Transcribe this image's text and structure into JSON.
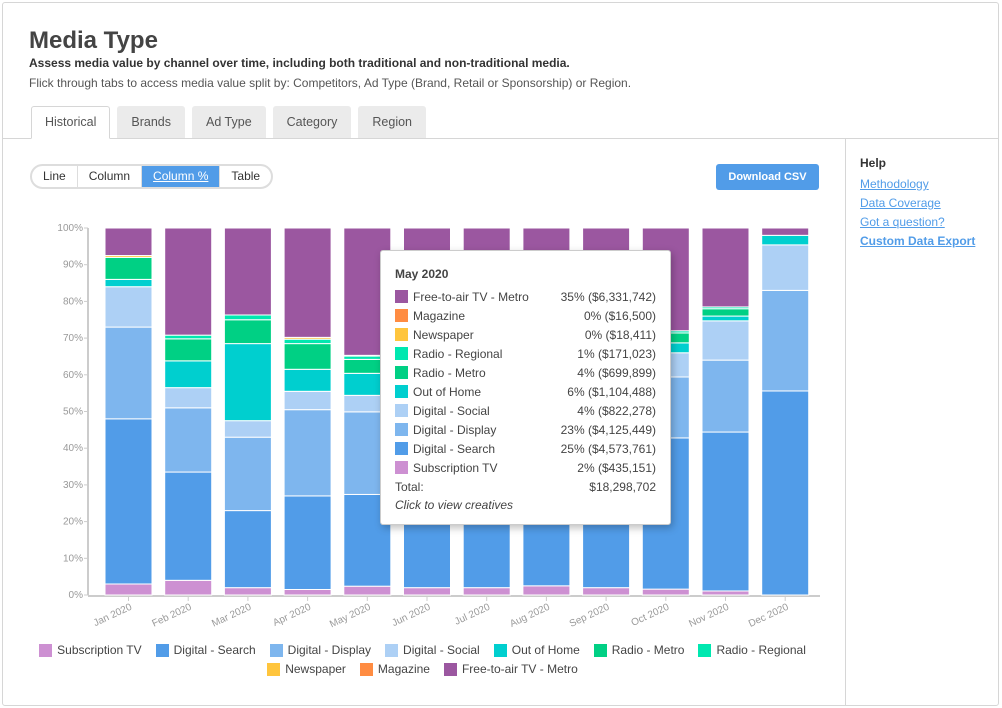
{
  "header": {
    "title": "Media Type",
    "subtitle": "Assess media value by channel over time, including both traditional and non-traditional media.",
    "description": "Flick through tabs to access media value split by: Competitors, Ad Type (Brand, Retail or Sponsorship) or Region."
  },
  "tabs": [
    {
      "label": "Historical",
      "active": true
    },
    {
      "label": "Brands"
    },
    {
      "label": "Ad Type"
    },
    {
      "label": "Category"
    },
    {
      "label": "Region"
    }
  ],
  "view_toggle": [
    {
      "label": "Line"
    },
    {
      "label": "Column"
    },
    {
      "label": "Column %",
      "active": true
    },
    {
      "label": "Table"
    }
  ],
  "download_label": "Download CSV",
  "help": {
    "title": "Help",
    "links": [
      "Methodology",
      "Data Coverage",
      "Got a question?",
      "Custom Data Export"
    ]
  },
  "legend": [
    "Subscription TV",
    "Digital - Search",
    "Digital - Display",
    "Digital - Social",
    "Out of Home",
    "Radio - Metro",
    "Radio - Regional",
    "Newspaper",
    "Magazine",
    "Free-to-air TV - Metro"
  ],
  "tooltip": {
    "title": "May 2020",
    "rows": [
      {
        "label": "Free-to-air TV - Metro",
        "value": "35% ($6,331,742)",
        "color": "#9b57a0"
      },
      {
        "label": "Magazine",
        "value": "0% ($16,500)",
        "color": "#ff8c42"
      },
      {
        "label": "Newspaper",
        "value": "0% ($18,411)",
        "color": "#ffc53d"
      },
      {
        "label": "Radio - Regional",
        "value": "1% ($171,023)",
        "color": "#00e8b0"
      },
      {
        "label": "Radio - Metro",
        "value": "4% ($699,899)",
        "color": "#00d084"
      },
      {
        "label": "Out of Home",
        "value": "6% ($1,104,488)",
        "color": "#00cfcf"
      },
      {
        "label": "Digital - Social",
        "value": "4% ($822,278)",
        "color": "#add0f5"
      },
      {
        "label": "Digital - Display",
        "value": "23% ($4,125,449)",
        "color": "#7eb6ee"
      },
      {
        "label": "Digital - Search",
        "value": "25% ($4,573,761)",
        "color": "#519ce8"
      },
      {
        "label": "Subscription TV",
        "value": "2% ($435,151)",
        "color": "#cd90d2"
      }
    ],
    "total_label": "Total:",
    "total_value": "$18,298,702",
    "hint": "Click to view creatives"
  },
  "chart_data": {
    "type": "bar",
    "stacked": "percent",
    "ylim": [
      0,
      100
    ],
    "yticks": [
      "0%",
      "10%",
      "20%",
      "30%",
      "40%",
      "50%",
      "60%",
      "70%",
      "80%",
      "90%",
      "100%"
    ],
    "categories": [
      "Jan 2020",
      "Feb 2020",
      "Mar 2020",
      "Apr 2020",
      "May 2020",
      "Jun 2020",
      "Jul 2020",
      "Aug 2020",
      "Sep 2020",
      "Oct 2020",
      "Nov 2020",
      "Dec 2020"
    ],
    "legend_position": "bottom",
    "series": [
      {
        "name": "Subscription TV",
        "color": "#cd90d2",
        "values": [
          3,
          4,
          2,
          1.5,
          2.4,
          2,
          2,
          2.5,
          2,
          1.6,
          1.1,
          0
        ]
      },
      {
        "name": "Digital - Search",
        "color": "#519ce8",
        "values": [
          45,
          29.5,
          21,
          25.5,
          25,
          30,
          32,
          30,
          35,
          41.2,
          43.3,
          55.6
        ]
      },
      {
        "name": "Digital - Display",
        "color": "#7eb6ee",
        "values": [
          25,
          17.5,
          20,
          23.5,
          22.5,
          22,
          20,
          22,
          20,
          16.6,
          19.6,
          27.4
        ]
      },
      {
        "name": "Digital - Social",
        "color": "#add0f5",
        "values": [
          11,
          5.5,
          4.5,
          5,
          4.5,
          5,
          5,
          5,
          6,
          6.6,
          10.7,
          12.4
        ]
      },
      {
        "name": "Out of Home",
        "color": "#00cfcf",
        "values": [
          2,
          7.3,
          21,
          6,
          6,
          5,
          5,
          5,
          5,
          2.7,
          1.3,
          2.6
        ]
      },
      {
        "name": "Radio - Metro",
        "color": "#00d084",
        "values": [
          6,
          6,
          6.5,
          7,
          3.8,
          3,
          4,
          4,
          3,
          2.7,
          2,
          0
        ]
      },
      {
        "name": "Radio - Regional",
        "color": "#00e8b0",
        "values": [
          0,
          1,
          1.3,
          1.2,
          0.9,
          1,
          1,
          1,
          1,
          0.6,
          0.5,
          0
        ]
      },
      {
        "name": "Newspaper",
        "color": "#ffc53d",
        "values": [
          0.5,
          0,
          0,
          0.5,
          0.1,
          0,
          0,
          0,
          0,
          0,
          0,
          0
        ]
      },
      {
        "name": "Magazine",
        "color": "#ff8c42",
        "values": [
          0,
          0,
          0,
          0,
          0.1,
          0,
          0,
          0,
          0,
          0,
          0,
          0
        ]
      },
      {
        "name": "Free-to-air TV - Metro",
        "color": "#9b57a0",
        "values": [
          7.5,
          29.2,
          23.7,
          29.8,
          34.7,
          32,
          31,
          30.5,
          28,
          28,
          21.5,
          2
        ]
      }
    ]
  }
}
